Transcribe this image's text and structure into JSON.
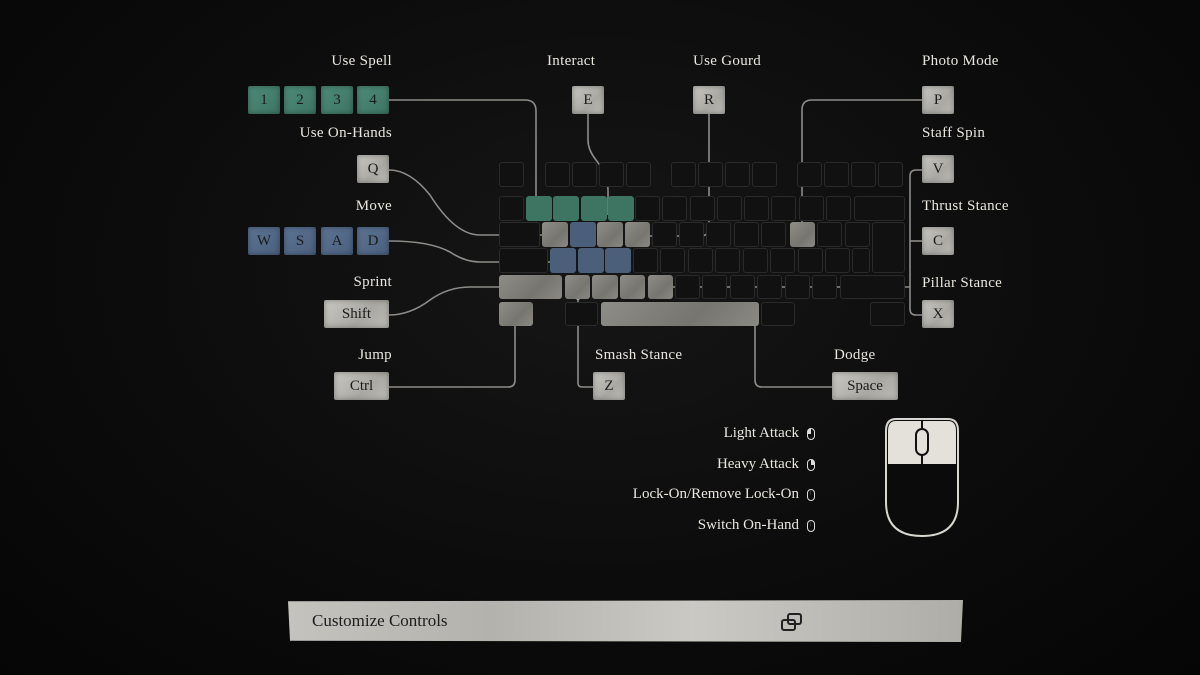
{
  "actions": {
    "use_spell": {
      "label": "Use Spell",
      "keys": [
        "1",
        "2",
        "3",
        "4"
      ]
    },
    "interact": {
      "label": "Interact",
      "keys": [
        "E"
      ]
    },
    "use_gourd": {
      "label": "Use Gourd",
      "keys": [
        "R"
      ]
    },
    "photo_mode": {
      "label": "Photo Mode",
      "keys": [
        "P"
      ]
    },
    "use_on_hands": {
      "label": "Use On-Hands",
      "keys": [
        "Q"
      ]
    },
    "staff_spin": {
      "label": "Staff Spin",
      "keys": [
        "V"
      ]
    },
    "move": {
      "label": "Move",
      "keys": [
        "W",
        "S",
        "A",
        "D"
      ]
    },
    "thrust_stance": {
      "label": "Thrust Stance",
      "keys": [
        "C"
      ]
    },
    "sprint": {
      "label": "Sprint",
      "keys": [
        "Shift"
      ]
    },
    "pillar_stance": {
      "label": "Pillar Stance",
      "keys": [
        "X"
      ]
    },
    "jump": {
      "label": "Jump",
      "keys": [
        "Ctrl"
      ]
    },
    "smash_stance": {
      "label": "Smash Stance",
      "keys": [
        "Z"
      ]
    },
    "dodge": {
      "label": "Dodge",
      "keys": [
        "Space"
      ]
    }
  },
  "mouse": [
    {
      "label": "Light Attack",
      "icon": "mouse-left-click-icon"
    },
    {
      "label": "Heavy Attack",
      "icon": "mouse-right-click-icon"
    },
    {
      "label": "Lock-On/Remove Lock-On",
      "icon": "mouse-middle-click-icon"
    },
    {
      "label": "Switch On-Hand",
      "icon": "mouse-scroll-icon"
    }
  ],
  "customize": {
    "label": "Customize Controls",
    "icon": "external-window-icon"
  },
  "colors": {
    "spell": "#3f7a68",
    "move": "#4f6480",
    "key": "#bdbcb7",
    "text": "#e9e6df",
    "background": "#0c0c0c"
  }
}
